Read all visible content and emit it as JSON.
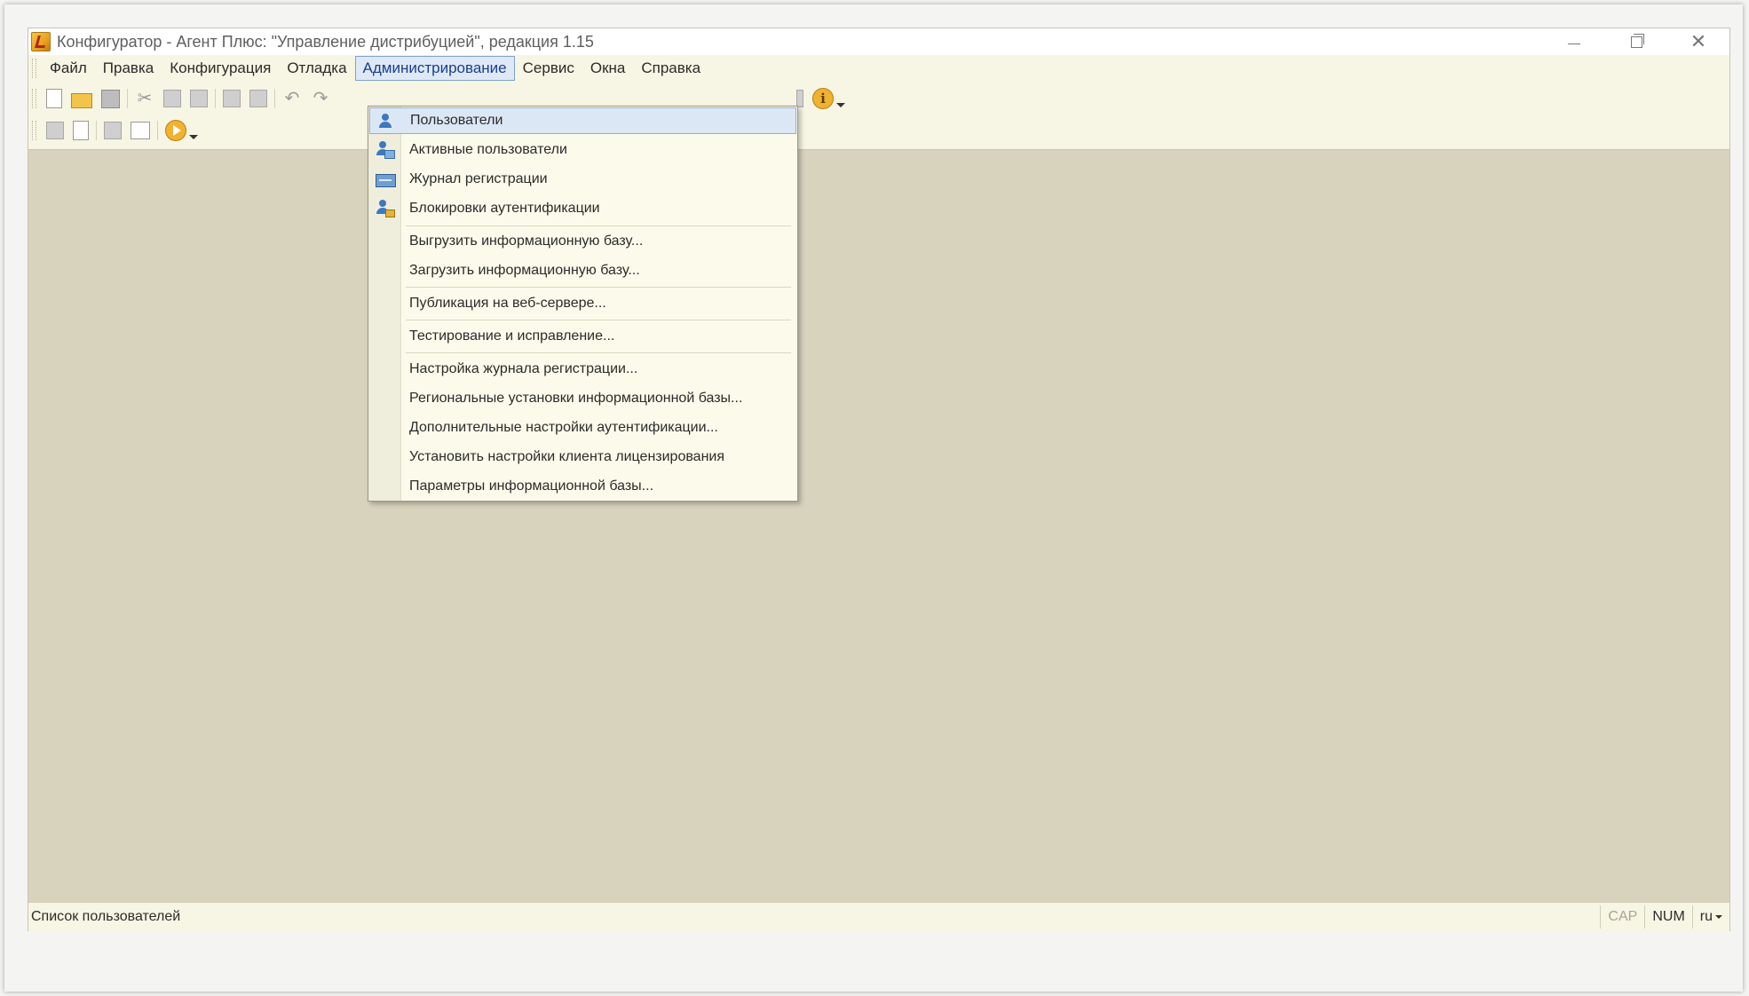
{
  "window": {
    "title": "Конфигуратор - Агент Плюс: \"Управление дистрибуцией\", редакция 1.15"
  },
  "menubar": {
    "items": [
      {
        "label": "Файл"
      },
      {
        "label": "Правка"
      },
      {
        "label": "Конфигурация"
      },
      {
        "label": "Отладка"
      },
      {
        "label": "Администрирование",
        "active": true
      },
      {
        "label": "Сервис"
      },
      {
        "label": "Окна"
      },
      {
        "label": "Справка"
      }
    ]
  },
  "admin_menu": {
    "items": [
      {
        "label": "Пользователи",
        "icon": "user-icon",
        "highlighted": true
      },
      {
        "label": "Активные пользователи",
        "icon": "active-users-icon"
      },
      {
        "label": "Журнал регистрации",
        "icon": "journal-icon"
      },
      {
        "label": "Блокировки аутентификации",
        "icon": "auth-lock-icon"
      },
      {
        "label": "Выгрузить информационную базу..."
      },
      {
        "label": "Загрузить информационную базу..."
      },
      {
        "label": "Публикация на веб-сервере..."
      },
      {
        "label": "Тестирование и исправление..."
      },
      {
        "label": "Настройка журнала регистрации..."
      },
      {
        "label": "Региональные установки информационной базы..."
      },
      {
        "label": "Дополнительные настройки аутентификации..."
      },
      {
        "label": "Установить настройки клиента лицензирования"
      },
      {
        "label": "Параметры информационной базы..."
      }
    ]
  },
  "toolbar": {
    "row1_icons": [
      "new-document-icon",
      "open-folder-icon",
      "save-icon",
      "cut-icon",
      "copy-icon",
      "paste-icon",
      "print-icon",
      "print-preview-icon",
      "undo-icon",
      "redo-icon",
      "info-icon"
    ],
    "row2_icons": [
      "config-db-icon",
      "compare-icon",
      "database-icon",
      "table-icon",
      "run-debug-icon"
    ]
  },
  "statusbar": {
    "message": "Список пользователей",
    "cap": "CAP",
    "num": "NUM",
    "lang": "ru"
  },
  "colors": {
    "workspace": "#d8d3bd",
    "chrome": "#f7f5e3",
    "highlight": "#dce7f5",
    "highlight_border": "#8fb0d8"
  }
}
